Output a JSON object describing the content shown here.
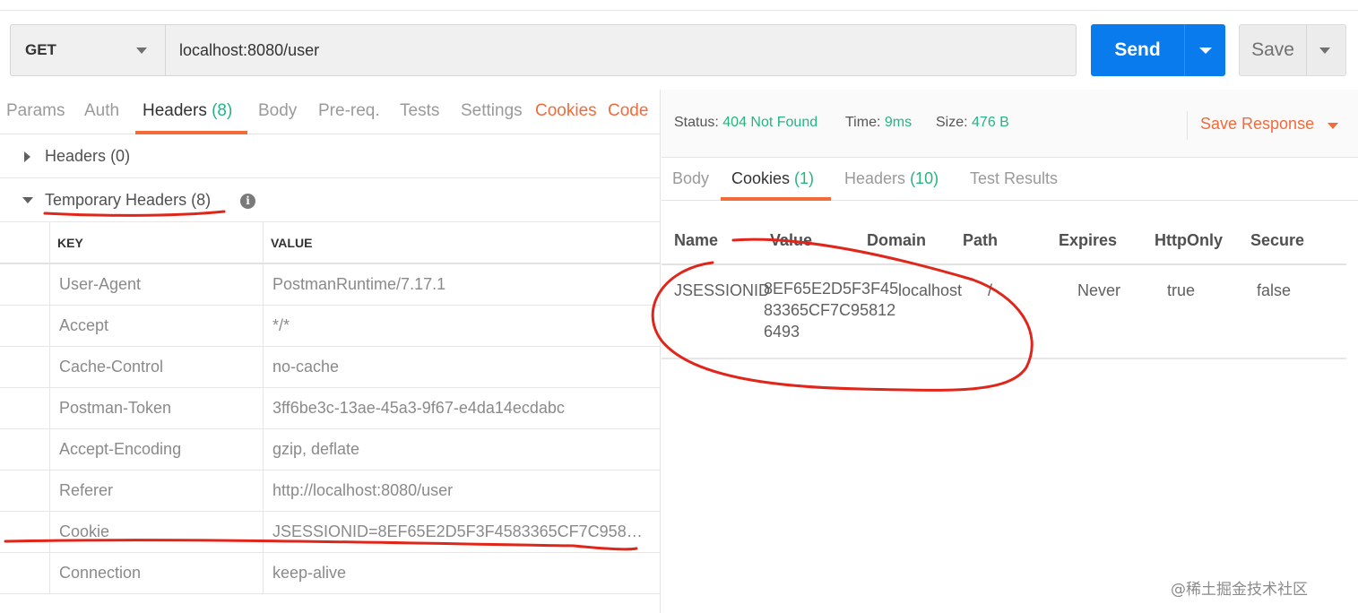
{
  "request": {
    "method": "GET",
    "url": "localhost:8080/user",
    "send_label": "Send",
    "save_label": "Save"
  },
  "request_tabs": [
    {
      "label": "Params"
    },
    {
      "label": "Auth"
    },
    {
      "label": "Headers",
      "count": "(8)",
      "active": true
    },
    {
      "label": "Body"
    },
    {
      "label": "Pre-req."
    },
    {
      "label": "Tests"
    },
    {
      "label": "Settings"
    },
    {
      "label": "Cookies"
    },
    {
      "label": "Code"
    }
  ],
  "headers_section": {
    "label": "Headers",
    "count": "(0)"
  },
  "temp_headers_section": {
    "label": "Temporary Headers",
    "count": "(8)",
    "info_icon": "info-icon"
  },
  "headers_table": {
    "columns": [
      "KEY",
      "VALUE"
    ],
    "rows": [
      {
        "key": "User-Agent",
        "value": "PostmanRuntime/7.17.1"
      },
      {
        "key": "Accept",
        "value": "*/*"
      },
      {
        "key": "Cache-Control",
        "value": "no-cache"
      },
      {
        "key": "Postman-Token",
        "value": "3ff6be3c-13ae-45a3-9f67-e4da14ecdabc"
      },
      {
        "key": "Accept-Encoding",
        "value": "gzip, deflate"
      },
      {
        "key": "Referer",
        "value": "http://localhost:8080/user"
      },
      {
        "key": "Cookie",
        "value": "JSESSIONID=8EF65E2D5F3F4583365CF7C958126..."
      },
      {
        "key": "Connection",
        "value": "keep-alive"
      }
    ]
  },
  "response_status": {
    "status_label": "Status:",
    "status_value": "404 Not Found",
    "time_label": "Time:",
    "time_value": "9ms",
    "size_label": "Size:",
    "size_value": "476 B",
    "save_response_label": "Save Response"
  },
  "response_tabs": [
    {
      "label": "Body"
    },
    {
      "label": "Cookies",
      "count": "(1)",
      "active": true
    },
    {
      "label": "Headers",
      "count": "(10)"
    },
    {
      "label": "Test Results"
    }
  ],
  "cookies_table": {
    "columns": [
      "Name",
      "Value",
      "Domain",
      "Path",
      "Expires",
      "HttpOnly",
      "Secure"
    ],
    "rows": [
      {
        "name": "JSESSIONID",
        "value": "8EF65E2D5F3F45\n83365CF7C95812\n6493",
        "domain": "localhost",
        "path": "/",
        "expires": "Never",
        "httponly": "true",
        "secure": "false"
      }
    ]
  },
  "watermark": "@稀土掘金技术社区",
  "colors": {
    "accent_orange": "#f26b3a",
    "send_blue": "#097bed",
    "status_green": "#26b47f",
    "annotation_red": "#e0261b"
  }
}
